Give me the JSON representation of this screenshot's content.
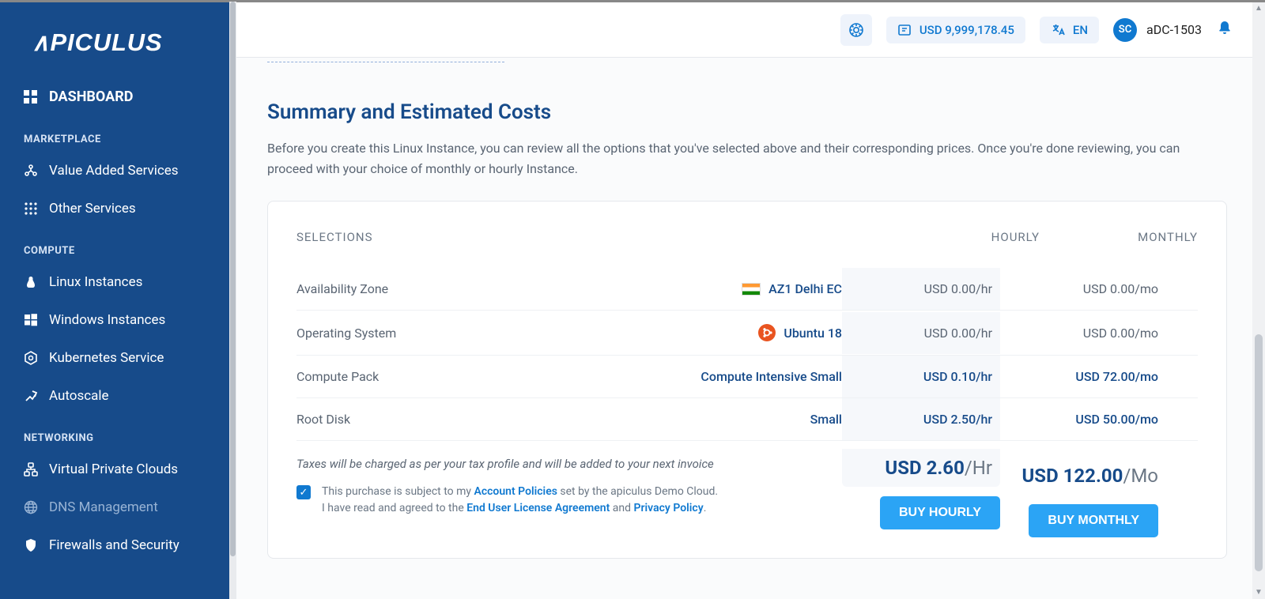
{
  "brand": "APICULUS",
  "topbar": {
    "balance": "USD 9,999,178.45",
    "language": "EN",
    "avatar_initials": "SC",
    "account": "aDC-1503"
  },
  "sidebar": {
    "dashboard": "DASHBOARD",
    "sections": {
      "marketplace": "MARKETPLACE",
      "compute": "COMPUTE",
      "networking": "NETWORKING"
    },
    "items": {
      "vas": "Value Added Services",
      "other": "Other Services",
      "linux": "Linux Instances",
      "windows": "Windows Instances",
      "kubernetes": "Kubernetes Service",
      "autoscale": "Autoscale",
      "vpc": "Virtual Private Clouds",
      "dns": "DNS Management",
      "firewalls": "Firewalls and Security"
    }
  },
  "page": {
    "title": "Summary and Estimated Costs",
    "description": "Before you create this Linux Instance, you can review all the options that you've selected above and their corresponding prices. Once you're done reviewing, you can proceed with your choice of monthly or hourly Instance."
  },
  "table": {
    "headers": {
      "selections": "SELECTIONS",
      "hourly": "HOURLY",
      "monthly": "MONTHLY"
    },
    "rows": [
      {
        "label": "Availability Zone",
        "value": "AZ1 Delhi EC",
        "icon": "flag-india",
        "hourly": "USD 0.00/hr",
        "monthly": "USD 0.00/mo"
      },
      {
        "label": "Operating System",
        "value": "Ubuntu 18",
        "icon": "ubuntu",
        "hourly": "USD 0.00/hr",
        "monthly": "USD 0.00/mo"
      },
      {
        "label": "Compute Pack",
        "value": "Compute Intensive Small",
        "icon": "",
        "hourly": "USD 0.10/hr",
        "monthly": "USD 72.00/mo"
      },
      {
        "label": "Root Disk",
        "value": "Small",
        "icon": "",
        "hourly": "USD 2.50/hr",
        "monthly": "USD 50.00/mo"
      }
    ],
    "tax_note": "Taxes will be charged as per your tax profile and will be added to your next invoice",
    "total_hourly": {
      "amount": "USD 2.60",
      "unit": "/Hr"
    },
    "total_monthly": {
      "amount": "USD 122.00",
      "unit": "/Mo"
    },
    "buy_hourly": "BUY HOURLY",
    "buy_monthly": "BUY MONTHLY"
  },
  "agree": {
    "line1_pre": "This purchase is subject to my ",
    "policies": "Account Policies",
    "line1_post": " set by the apiculus Demo Cloud.",
    "line2_pre": "I have read and agreed to the ",
    "eula": "End User License Agreement",
    "and": " and ",
    "privacy": "Privacy Policy",
    "dot": "."
  }
}
